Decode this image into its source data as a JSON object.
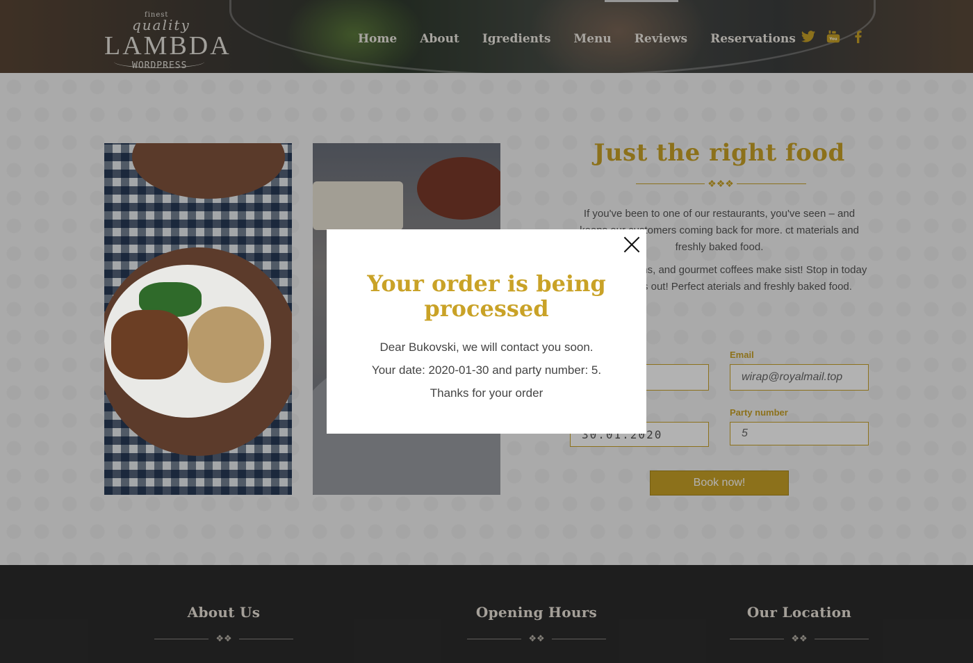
{
  "logo": {
    "finest": "finest",
    "quality": "quality",
    "name": "LAMBDA",
    "sub": "WORDPRESS"
  },
  "nav": [
    "Home",
    "About",
    "Igredients",
    "Menu",
    "Reviews",
    "Reservations"
  ],
  "social": [
    {
      "icon": "twitter-icon",
      "glyph": "🐦"
    },
    {
      "icon": "youtube-icon",
      "glyph": "▶"
    },
    {
      "icon": "facebook-icon",
      "glyph": "f"
    }
  ],
  "section": {
    "title": "Just the right food",
    "paragraph1": "If you've been to one of our restaurants, you've seen – and keeps our customers coming back for more. ct materials and freshly baked food.",
    "paragraph2": "da cakes, muffins, and gourmet coffees make sist! Stop in today and check us out! Perfect aterials and freshly baked food."
  },
  "form": {
    "email_label": "Email",
    "email_value": "wirap@royalmail.top",
    "date_value": "30.01.2020",
    "party_label": "Party number",
    "party_value": "5",
    "book_label": "Book now!"
  },
  "footer": {
    "about_title": "About Us",
    "hours_title": "Opening Hours",
    "location_title": "Our Location"
  },
  "modal": {
    "title": "Your order is being processed",
    "line1": "Dear Bukovski, we will contact you soon.",
    "line2": "Your date: 2020-01-30 and party number: 5.",
    "line3": "Thanks for your order"
  },
  "colors": {
    "accent": "#c9a227",
    "footer_bg": "#2c2c2c"
  }
}
